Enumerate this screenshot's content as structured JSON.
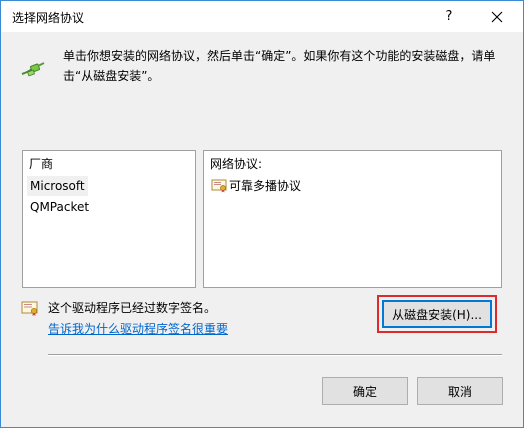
{
  "window": {
    "title": "选择网络协议",
    "help_label": "?",
    "instructions": "单击你想安装的网络协议，然后单击“确定”。如果你有这个功能的安装磁盘，请单击“从磁盘安装”。"
  },
  "vendor_list": {
    "header": "厂商",
    "items": [
      "Microsoft",
      "QMPacket"
    ],
    "selected": "Microsoft"
  },
  "protocol_list": {
    "header": "网络协议:",
    "items": [
      "可靠多播协议"
    ]
  },
  "signature": {
    "text": "这个驱动程序已经过数字签名。",
    "link": "告诉我为什么驱动程序签名很重要"
  },
  "buttons": {
    "have_disk": "从磁盘安装(H)...",
    "ok": "确定",
    "cancel": "取消"
  },
  "colors": {
    "accent": "#0078d7",
    "highlight_box": "#e02a2a",
    "link": "#0066cc"
  }
}
